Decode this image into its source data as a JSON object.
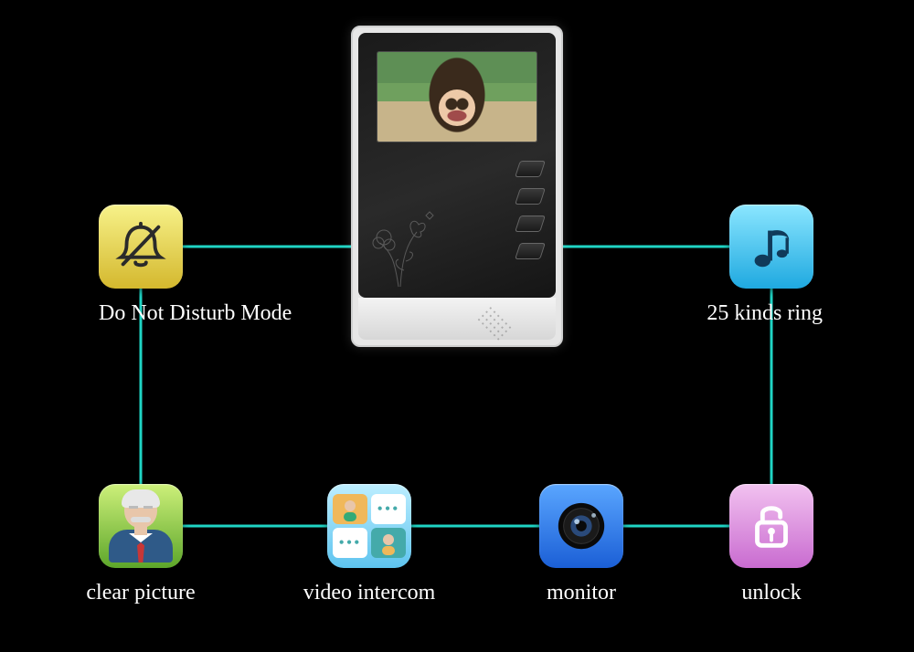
{
  "features": {
    "dnd": {
      "label": "Do Not Disturb Mode",
      "icon": "bell-off-icon",
      "color": "yellow"
    },
    "ring": {
      "label": "25 kinds ring",
      "icon": "music-note-icon",
      "color": "cyan"
    },
    "clear": {
      "label": "clear picture",
      "icon": "person-avatar-icon",
      "color": "green"
    },
    "video": {
      "label": "video intercom",
      "icon": "video-chat-icon",
      "color": "skyblue"
    },
    "monitor": {
      "label": "monitor",
      "icon": "camera-lens-icon",
      "color": "blue"
    },
    "unlock": {
      "label": "unlock",
      "icon": "lock-open-icon",
      "color": "pink"
    }
  },
  "device": {
    "name": "indoor-monitor",
    "button_count": 4
  },
  "colors": {
    "connector": "#1fd4c4"
  }
}
